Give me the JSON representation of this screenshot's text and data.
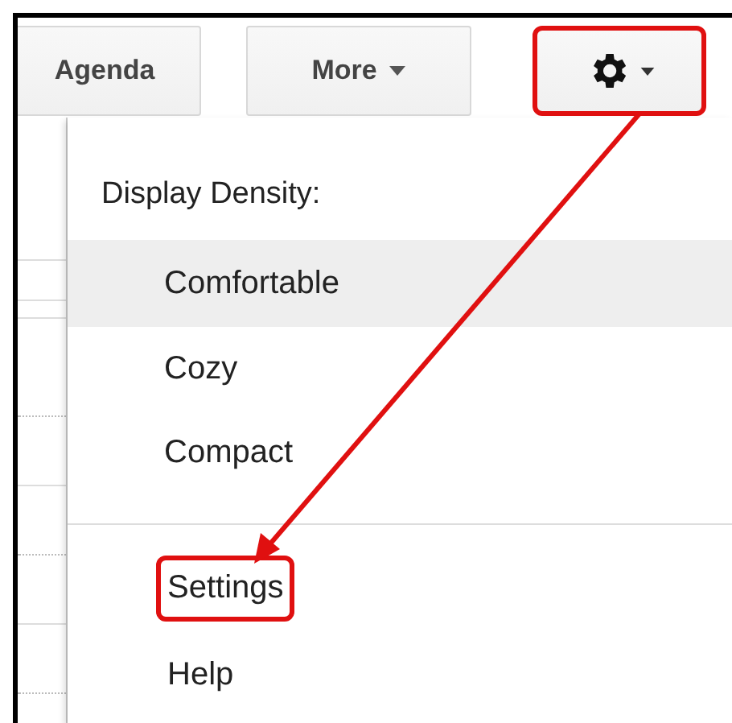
{
  "toolbar": {
    "buttons": [
      {
        "kind": "text",
        "label": "Agenda",
        "annotated": false
      },
      {
        "kind": "dropdown",
        "label": "More",
        "annotated": false
      },
      {
        "kind": "settings",
        "annotated": true
      }
    ]
  },
  "menu": {
    "heading": "Display Density:",
    "density_options": [
      {
        "label": "Comfortable",
        "selected": true
      },
      {
        "label": "Cozy",
        "selected": false
      },
      {
        "label": "Compact",
        "selected": false
      }
    ],
    "items": [
      {
        "label": "Settings",
        "annotated": true
      },
      {
        "label": "Help",
        "annotated": false
      }
    ]
  }
}
